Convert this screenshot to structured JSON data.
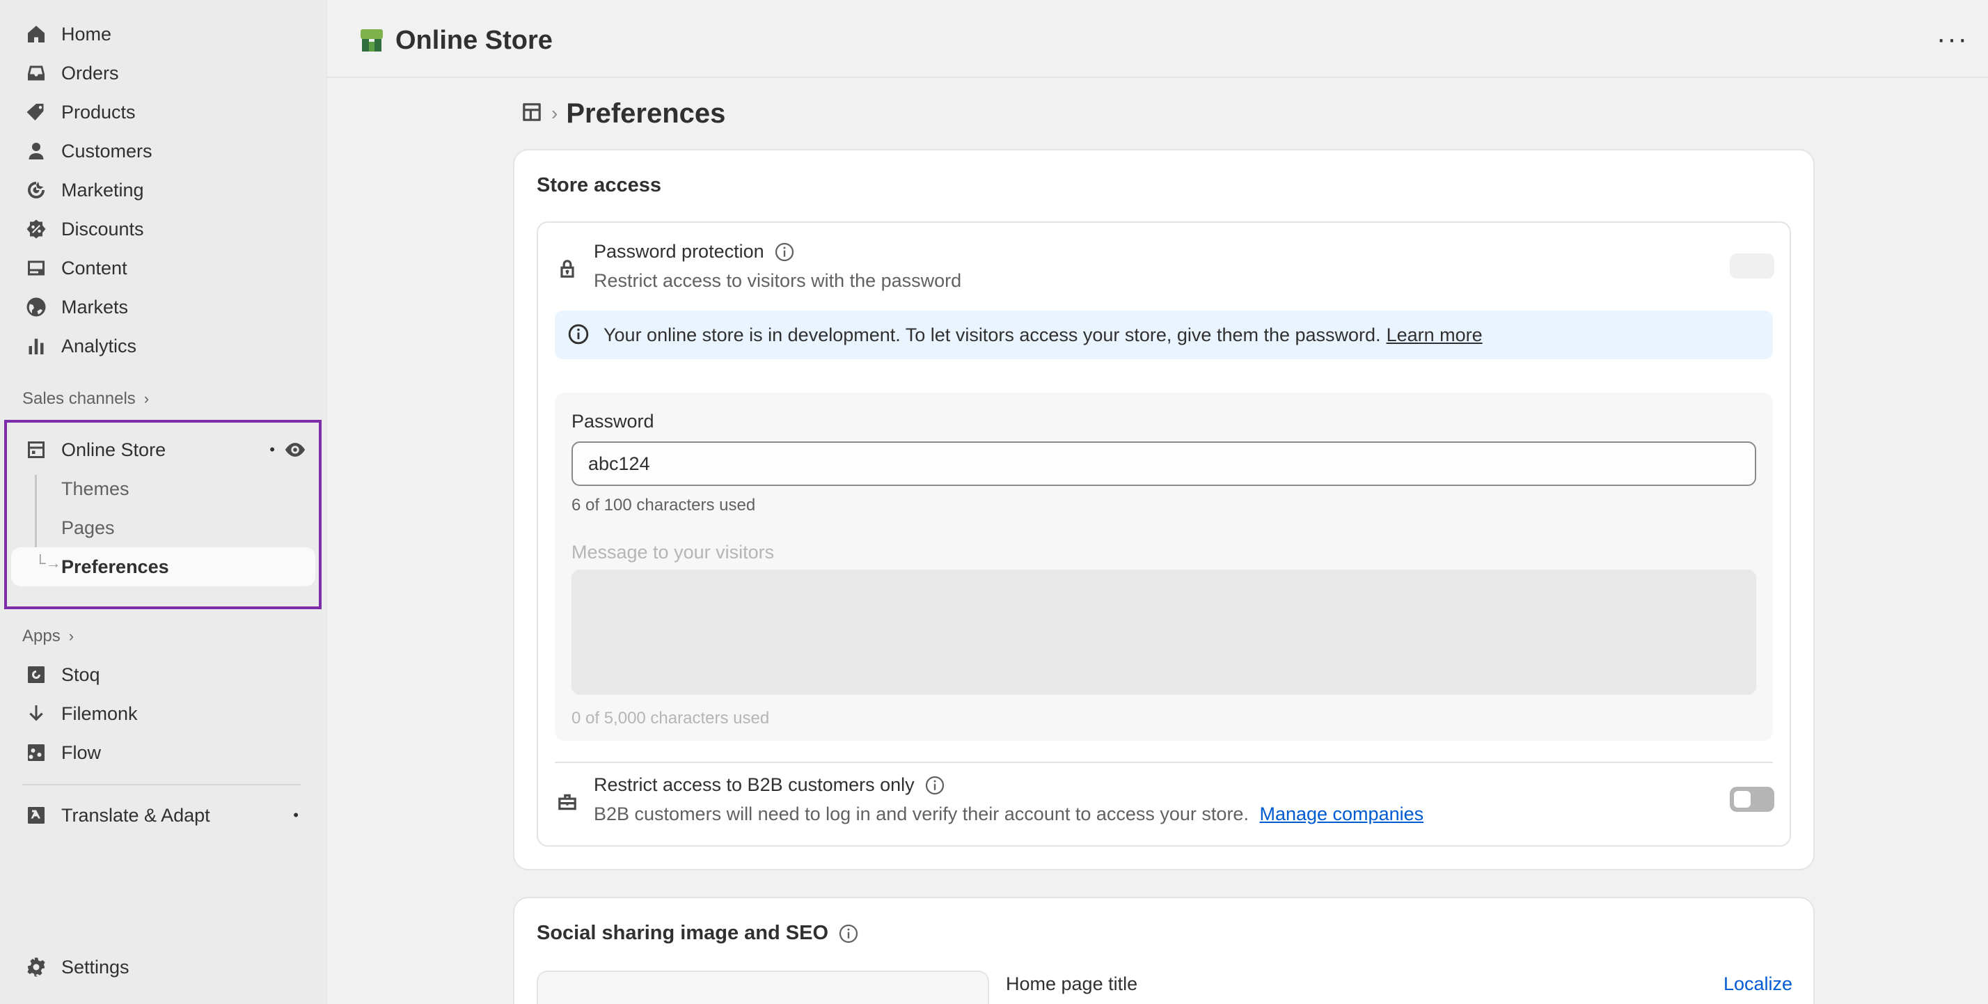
{
  "sidebar": {
    "items": [
      {
        "label": "Home",
        "icon": "home-icon"
      },
      {
        "label": "Orders",
        "icon": "inbox-icon"
      },
      {
        "label": "Products",
        "icon": "tag-icon"
      },
      {
        "label": "Customers",
        "icon": "person-icon"
      },
      {
        "label": "Marketing",
        "icon": "target-icon"
      },
      {
        "label": "Discounts",
        "icon": "discount-icon"
      },
      {
        "label": "Content",
        "icon": "image-icon"
      },
      {
        "label": "Markets",
        "icon": "globe-icon"
      },
      {
        "label": "Analytics",
        "icon": "bar-chart-icon"
      }
    ],
    "sales_channels_label": "Sales channels",
    "online_store": {
      "label": "Online Store",
      "subitems": [
        "Themes",
        "Pages",
        "Preferences"
      ]
    },
    "apps_label": "Apps",
    "apps": [
      {
        "label": "Stoq",
        "icon": "stoq-icon"
      },
      {
        "label": "Filemonk",
        "icon": "arrow-down-icon"
      },
      {
        "label": "Flow",
        "icon": "flow-icon"
      }
    ],
    "translate_label": "Translate & Adapt",
    "settings_label": "Settings"
  },
  "topbar": {
    "title": "Online Store",
    "more": "···"
  },
  "breadcrumb": {
    "sep": "›",
    "title": "Preferences"
  },
  "store_access": {
    "title": "Store access",
    "password_protection": {
      "title": "Password protection",
      "subtitle": "Restrict access to visitors with the password"
    },
    "banner": {
      "text": "Your online store is in development. To let visitors access your store, give them the password.",
      "link": "Learn more"
    },
    "password": {
      "label": "Password",
      "value": "abc124",
      "help": "6 of 100 characters used"
    },
    "message": {
      "label": "Message to your visitors",
      "value": "",
      "help": "0 of 5,000 characters used"
    },
    "b2b": {
      "title": "Restrict access to B2B customers only",
      "subtitle": "B2B customers will need to log in and verify their account to access your store.",
      "link": "Manage companies"
    }
  },
  "seo": {
    "title": "Social sharing image and SEO",
    "home_page_title_label": "Home page title",
    "localize": "Localize"
  },
  "colors": {
    "highlight_border": "#7b2ea8",
    "link_blue": "#005bd3",
    "banner_bg": "#eaf4ff"
  }
}
